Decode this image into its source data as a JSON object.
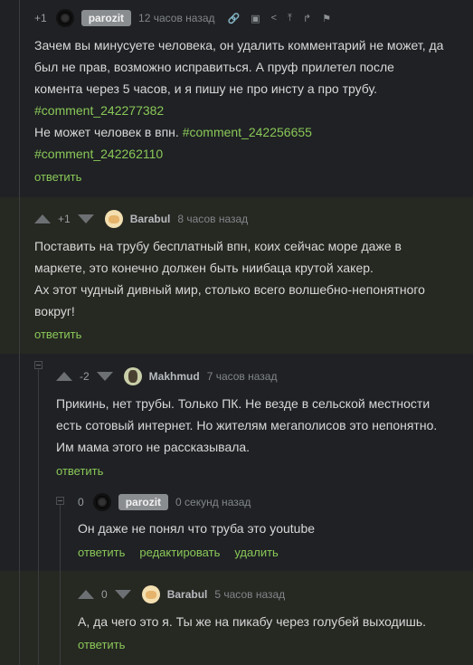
{
  "comments": [
    {
      "rating": "+1",
      "author": "parozit",
      "time": "12 часов назад",
      "lines": [
        "Зачем вы минусуете человека, он удалить комментарий не может, да",
        "был не прав, возможно исправиться. А пруф прилетел после",
        "комента через 5 часов, и я пишу не про инсту а про трубу."
      ],
      "link1": "#comment_242277382",
      "line5_text": "Не может человек в впн. ",
      "link2": "#comment_242256655",
      "link3": "#comment_242262110",
      "reply": "ответить"
    },
    {
      "rating": "+1",
      "author": "Barabul",
      "time": "8 часов назад",
      "lines": [
        "Поставить на трубу бесплатный впн, коих сейчас море даже в",
        "маркете, это конечно должен быть ниибаца крутой хакер.",
        "Ах этот чудный дивный мир, столько всего волшебно-непонятного",
        "вокруг!"
      ],
      "reply": "ответить"
    },
    {
      "rating": "-2",
      "author": "Makhmud",
      "time": "7 часов назад",
      "lines": [
        "Прикинь, нет трубы. Только ПК. Не везде в сельской местности",
        "есть сотовый интернет. Но жителям мегаполисов это непонятно.",
        "Им мама этого не рассказывала."
      ],
      "reply": "ответить"
    },
    {
      "rating": "0",
      "author": "parozit",
      "time": "0 секунд назад",
      "lines": [
        "Он даже не понял что труба это youtube"
      ],
      "reply": "ответить",
      "edit": "редактировать",
      "delete": "удалить"
    },
    {
      "rating": "0",
      "author": "Barabul",
      "time": "5 часов назад",
      "lines": [
        "А, да чего это я. Ты же на пикабу через голубей выходишь."
      ],
      "reply": "ответить"
    }
  ],
  "icons": {
    "link": "link-icon",
    "save": "save-icon",
    "share": "share-icon",
    "up": "go-up-icon",
    "branch": "branch-icon",
    "report": "flag-icon"
  }
}
